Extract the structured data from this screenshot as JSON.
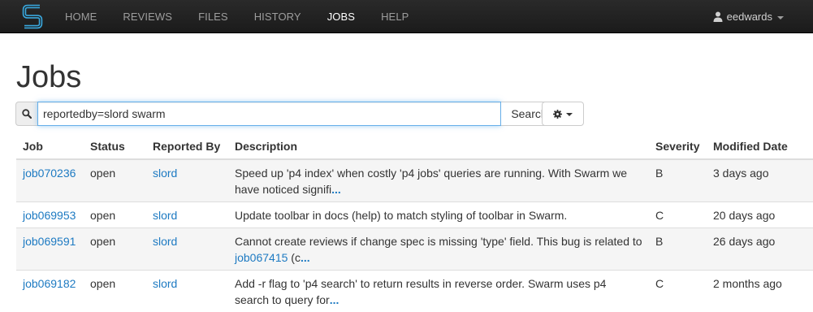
{
  "navbar": {
    "brand_icon": "swarm-logo-icon",
    "items": [
      {
        "label": "HOME",
        "active": false
      },
      {
        "label": "REVIEWS",
        "active": false
      },
      {
        "label": "FILES",
        "active": false
      },
      {
        "label": "HISTORY",
        "active": false
      },
      {
        "label": "JOBS",
        "active": true
      },
      {
        "label": "HELP",
        "active": false
      }
    ],
    "user": {
      "name": "eedwards",
      "icon": "user-icon"
    }
  },
  "page": {
    "title": "Jobs"
  },
  "search": {
    "icon": "search-icon",
    "value": "reportedby=slord swarm",
    "button_label": "Search",
    "settings_icon": "gear-icon"
  },
  "table": {
    "columns": [
      "Job",
      "Status",
      "Reported By",
      "Description",
      "Severity",
      "Modified Date"
    ],
    "rows": [
      {
        "job": "job070236",
        "status": "open",
        "reported_by": "slord",
        "description": "Speed up 'p4 index' when costly 'p4 jobs' queries are running. With Swarm we have noticed signifi",
        "more": "...",
        "severity": "B",
        "modified": "3 days ago"
      },
      {
        "job": "job069953",
        "status": "open",
        "reported_by": "slord",
        "description": "Update toolbar in docs (help) to match styling of toolbar in Swarm.",
        "more": "",
        "severity": "C",
        "modified": "20 days ago"
      },
      {
        "job": "job069591",
        "status": "open",
        "reported_by": "slord",
        "description": "Cannot create reviews if change spec is missing 'type' field. This bug is related to ",
        "desc_link": "job067415",
        "desc_after": " (c",
        "more": "...",
        "severity": "B",
        "modified": "26 days ago"
      },
      {
        "job": "job069182",
        "status": "open",
        "reported_by": "slord",
        "description": "Add -r flag to 'p4 search' to return results in reverse order. Swarm uses p4 search to query for",
        "more": "...",
        "severity": "C",
        "modified": "2 months ago"
      }
    ]
  },
  "colors": {
    "navbar_bg": "#222222",
    "link": "#1d7ac2",
    "focus_border": "#66afe9",
    "row_stripe": "#f5f5f5"
  }
}
